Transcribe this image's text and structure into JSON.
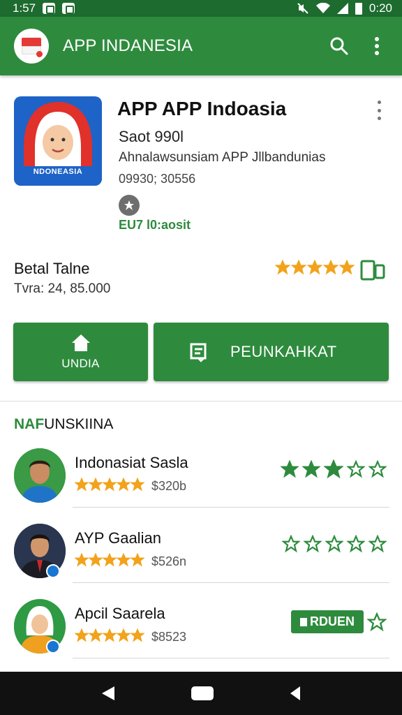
{
  "status_bar": {
    "time": "1:57",
    "clock": "0:20"
  },
  "app_bar": {
    "title": "APP INDANESIA"
  },
  "app": {
    "name": "APP APP Indoasia",
    "developer": "Saot 990l",
    "description": "Ahnalawsunsiam APP Jllbandunias",
    "count": "09930; 30556",
    "badge_text": "EU7 l0:aosit",
    "icon_label": "NDONEASIA",
    "stat_title": "Betal Talne",
    "stat_sub": "Tvra: 24, 85.000",
    "stars_filled": 5
  },
  "buttons": {
    "install_label": "UNDIA",
    "download_label": "PEUNKAHKAT"
  },
  "section": {
    "prefix": "NAF",
    "title": "UNSKIINA"
  },
  "list": [
    {
      "name": "Indonasiat Sasla",
      "price": "$320b",
      "rating_stars": 5,
      "right_stars_filled": 3,
      "right_stars_total": 5
    },
    {
      "name": "AYP Gaalian",
      "price": "$526n",
      "rating_stars": 5,
      "right_stars_filled": 0,
      "right_stars_total": 5
    },
    {
      "name": "Apcil Saarela",
      "price": "$8523",
      "rating_stars": 5,
      "tag": "RDUEN"
    }
  ],
  "colors": {
    "primary": "#2e8b3d",
    "status_bar": "#1d6b2f",
    "star_gold": "#f2a31b",
    "star_green": "#2e8b3d",
    "icon_blue": "#1e63c7"
  }
}
